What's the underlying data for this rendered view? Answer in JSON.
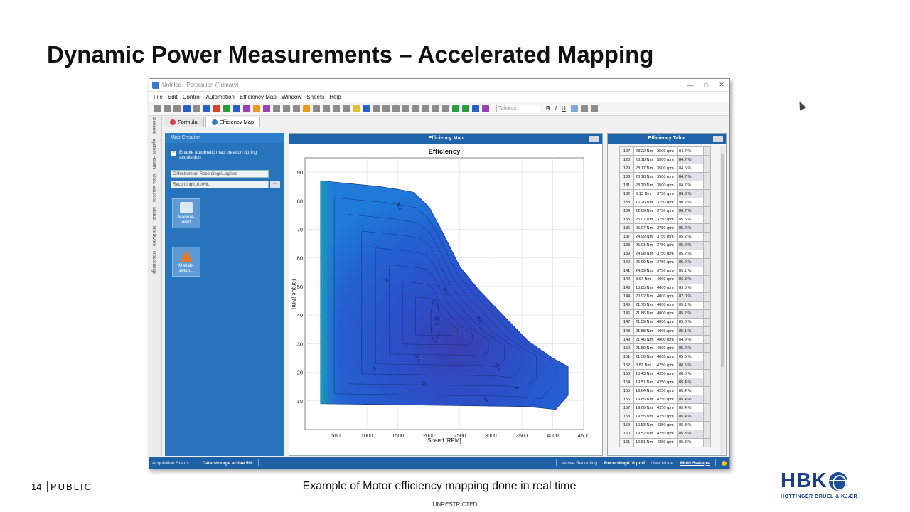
{
  "slide": {
    "title": "Dynamic Power Measurements – Accelerated Mapping",
    "caption": "Example of Motor efficiency mapping done in real time",
    "slide_number": "14",
    "classification": "PUBLIC",
    "footer_center": "UNRESTRICTED",
    "logo_text": "HBK",
    "logo_subtitle": "HOTTINGER BRÜEL & KJÆR"
  },
  "app": {
    "window_title": "Untitled - Perception (Primary)",
    "menu": [
      "File",
      "Edit",
      "Control",
      "Automation",
      "Efficiency Map",
      "Window",
      "Sheets",
      "Help"
    ],
    "font_select": "Tahoma",
    "format_buttons": [
      "B",
      "I",
      "U"
    ],
    "sheet_tabs": [
      "Formula",
      "Efficiency Map"
    ],
    "side_tabs": [
      "Sensors",
      "System Health",
      "Data Sources",
      "Status",
      "Hardware",
      "Recordings"
    ]
  },
  "left_panel": {
    "header": "Map Creation",
    "checkbox_label": "Enable automatic map creation during acquisition",
    "checkbox_checked": true,
    "path": "C:\\Instrument Recordings\\Logfiles",
    "file": "Recording016.XML",
    "browse_label": "...",
    "manual_button": "Manual-read",
    "matlab_button": "Matlab-setup..."
  },
  "map_panel": {
    "header": "Efficiency Map"
  },
  "table_panel": {
    "header": "Efficiency Table",
    "rows": [
      [
        "127",
        "28.22 Nm",
        "3500 rpm",
        "84.7 %"
      ],
      [
        "128",
        "28.18 Nm",
        "3500 rpm",
        "84.7 %"
      ],
      [
        "129",
        "28.17 Nm",
        "3500 rpm",
        "84.6 %"
      ],
      [
        "130",
        "28.18 Nm",
        "3500 rpm",
        "84.7 %"
      ],
      [
        "131",
        "28.19 Nm",
        "3500 rpm",
        "84.7 %"
      ],
      [
        "132",
        "6.13 Nm",
        "3750 rpm",
        "86.6 %"
      ],
      [
        "133",
        "16.26 Nm",
        "3750 rpm",
        "90.2 %"
      ],
      [
        "134",
        "22.09 Nm",
        "3750 rpm",
        "86.7 %"
      ],
      [
        "135",
        "25.07 Nm",
        "3750 rpm",
        "85.5 %"
      ],
      [
        "136",
        "25.07 Nm",
        "3750 rpm",
        "85.2 %"
      ],
      [
        "137",
        "24.99 Nm",
        "3750 rpm",
        "85.2 %"
      ],
      [
        "138",
        "25.01 Nm",
        "3750 rpm",
        "85.2 %"
      ],
      [
        "139",
        "24.98 Nm",
        "3750 rpm",
        "85.2 %"
      ],
      [
        "140",
        "25.09 Nm",
        "3750 rpm",
        "85.2 %"
      ],
      [
        "141",
        "24.99 Nm",
        "3750 rpm",
        "85.1 %"
      ],
      [
        "142",
        "8.97 Nm",
        "4000 rpm",
        "86.8 %"
      ],
      [
        "143",
        "15.85 Nm",
        "4000 rpm",
        "89.5 %"
      ],
      [
        "144",
        "20.92 Nm",
        "4000 rpm",
        "87.0 %"
      ],
      [
        "145",
        "21.75 Nm",
        "4000 rpm",
        "85.1 %"
      ],
      [
        "146",
        "21.86 Nm",
        "4000 rpm",
        "85.2 %"
      ],
      [
        "147",
        "21.59 Nm",
        "4000 rpm",
        "85.0 %"
      ],
      [
        "148",
        "21.88 Nm",
        "4000 rpm",
        "85.1 %"
      ],
      [
        "149",
        "21.46 Nm",
        "4000 rpm",
        "84.9 %"
      ],
      [
        "150",
        "21.89 Nm",
        "4000 rpm",
        "85.2 %"
      ],
      [
        "151",
        "21.50 Nm",
        "4000 rpm",
        "85.0 %"
      ],
      [
        "152",
        "8.81 Nm",
        "4250 rpm",
        "86.5 %"
      ],
      [
        "153",
        "15.43 Nm",
        "4250 rpm",
        "88.0 %"
      ],
      [
        "154",
        "19.51 Nm",
        "4250 rpm",
        "85.4 %"
      ],
      [
        "155",
        "19.64 Nm",
        "4250 rpm",
        "85.4 %"
      ],
      [
        "156",
        "19.65 Nm",
        "4250 rpm",
        "85.4 %"
      ],
      [
        "157",
        "19.60 Nm",
        "4250 rpm",
        "85.4 %"
      ],
      [
        "158",
        "19.55 Nm",
        "4250 rpm",
        "85.4 %"
      ],
      [
        "159",
        "19.53 Nm",
        "4250 rpm",
        "85.3 %"
      ],
      [
        "160",
        "19.52 Nm",
        "4250 rpm",
        "85.3 %"
      ],
      [
        "161",
        "19.51 Nm",
        "4250 rpm",
        "85.3 %"
      ]
    ]
  },
  "status_bar": {
    "acq_label": "Acquisition Status:",
    "acq_value": "Data storage active 5%",
    "rec_label": "Active Recording:",
    "rec_value": "Recording016.pnrf",
    "mode_label": "User Mode:",
    "mode_value": "Multi Sweeps"
  },
  "chart_data": {
    "type": "contour",
    "title": "Efficiency",
    "xlabel": "Speed [RPM]",
    "ylabel": "Torque [Nm]",
    "xlim": [
      0,
      4500
    ],
    "ylim": [
      0,
      95
    ],
    "xticks": [
      500,
      1000,
      1500,
      2000,
      2500,
      3000,
      3500,
      4000,
      4500
    ],
    "yticks": [
      10,
      20,
      30,
      40,
      50,
      60,
      70,
      80,
      90
    ],
    "grid": true,
    "boundary": [
      [
        250,
        87
      ],
      [
        1200,
        85
      ],
      [
        1500,
        84
      ],
      [
        1750,
        83
      ],
      [
        2000,
        78
      ],
      [
        2200,
        70
      ],
      [
        2500,
        57
      ],
      [
        2800,
        49
      ],
      [
        3200,
        40
      ],
      [
        3600,
        31
      ],
      [
        4000,
        25
      ],
      [
        4250,
        22
      ],
      [
        4250,
        12
      ],
      [
        4050,
        7
      ],
      [
        3600,
        8
      ],
      [
        250,
        9
      ]
    ],
    "efficiency_peak": {
      "speed": 2100,
      "torque": 38,
      "label": "93.3"
    },
    "contour_labels": [
      {
        "speed": 1100,
        "torque": 21,
        "label": "91"
      },
      {
        "speed": 1900,
        "torque": 16,
        "label": "92"
      },
      {
        "speed": 2250,
        "torque": 48,
        "label": "91.5"
      },
      {
        "speed": 1800,
        "torque": 25,
        "label": "91.5"
      },
      {
        "speed": 3100,
        "torque": 22,
        "label": "91.5"
      },
      {
        "speed": 2800,
        "torque": 38,
        "label": "90.5"
      },
      {
        "speed": 1300,
        "torque": 52,
        "label": "88"
      },
      {
        "speed": 1500,
        "torque": 78,
        "label": "88.5"
      },
      {
        "speed": 2900,
        "torque": 10,
        "label": "89"
      },
      {
        "speed": 3400,
        "torque": 14,
        "label": "87"
      }
    ]
  }
}
